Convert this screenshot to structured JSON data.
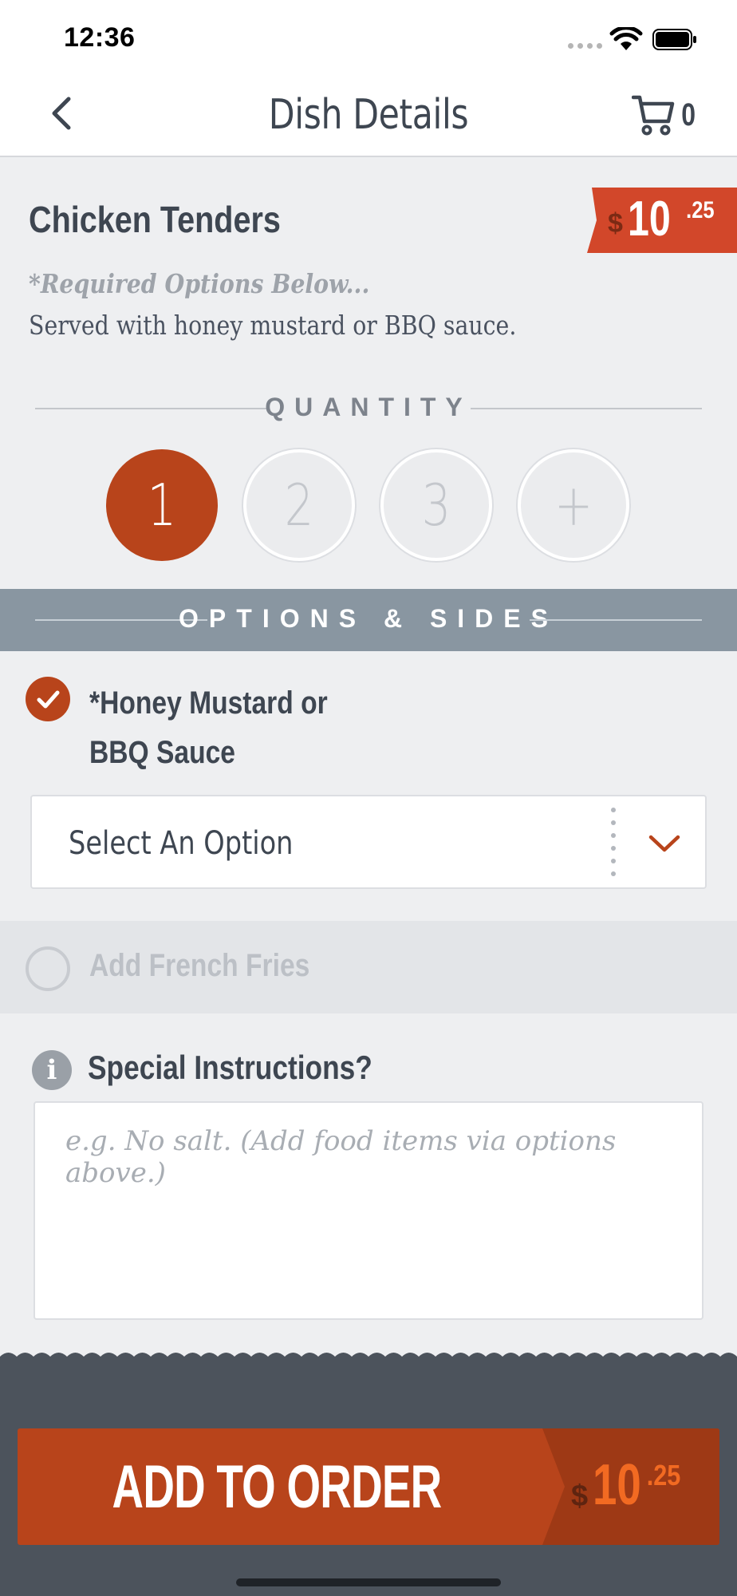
{
  "status_bar": {
    "time": "12:36"
  },
  "nav": {
    "title": "Dish Details",
    "cart_count": "0"
  },
  "dish": {
    "name": "Chicken Tenders",
    "price_symbol": "$",
    "price_dollars": "10",
    "price_cents": ".25",
    "required_note": "*Required Options Below...",
    "description": "Served with honey mustard or BBQ sauce."
  },
  "quantity": {
    "label": "QUANTITY",
    "options": [
      "1",
      "2",
      "3",
      "+"
    ],
    "selected": "1"
  },
  "options_section": {
    "label": "OPTIONS & SIDES",
    "sauce": {
      "title": "*Honey Mustard or BBQ Sauce",
      "checked": true,
      "select_value": "Select An Option"
    },
    "fries": {
      "label": "Add French Fries",
      "checked": false
    }
  },
  "instructions": {
    "label": "Special Instructions?",
    "placeholder": "e.g. No salt. (Add food items via options above.)",
    "value": ""
  },
  "footer": {
    "add_label": "ADD TO ORDER",
    "price_symbol": "$",
    "price_dollars": "10",
    "price_cents": ".25"
  },
  "colors": {
    "accent": "#b8441b",
    "price_tag": "#d2472a",
    "band": "#8996a1",
    "footer_bg": "#4c535c",
    "text": "#3e4651"
  },
  "icons": [
    "back-chevron-icon",
    "cart-icon",
    "check-icon",
    "chevron-down-icon",
    "info-icon",
    "wifi-icon",
    "battery-icon"
  ]
}
